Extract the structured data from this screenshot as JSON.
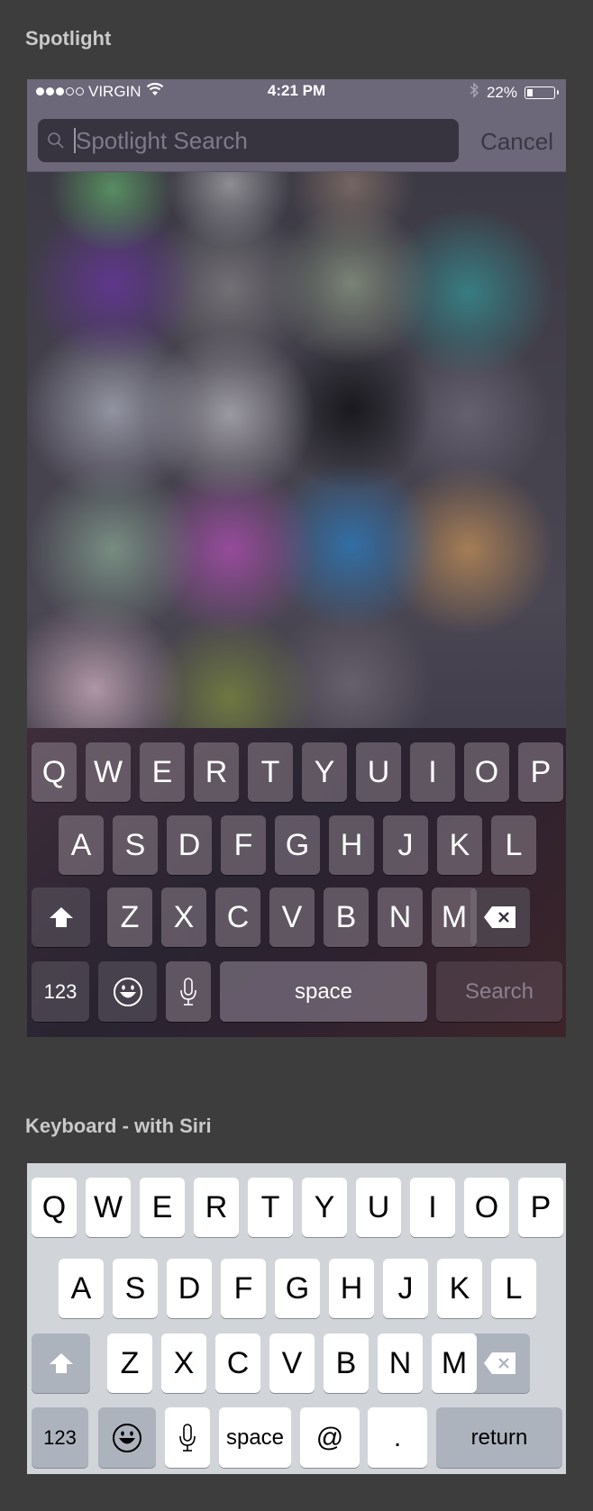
{
  "sections": {
    "spotlight_title": "Spotlight",
    "keyboard_title": "Keyboard - with Siri"
  },
  "status_bar": {
    "signal_strength_filled": 3,
    "signal_strength_total": 5,
    "carrier": "VIRGIN",
    "time": "4:21 PM",
    "battery_percent": "22%",
    "battery_level": 0.22,
    "icons": [
      "wifi-icon",
      "bluetooth-icon",
      "battery-icon"
    ]
  },
  "search": {
    "placeholder": "Spotlight Search",
    "value": "",
    "cancel_label": "Cancel"
  },
  "dark_keyboard": {
    "row1": [
      "Q",
      "W",
      "E",
      "R",
      "T",
      "Y",
      "U",
      "I",
      "O",
      "P"
    ],
    "row2": [
      "A",
      "S",
      "D",
      "F",
      "G",
      "H",
      "J",
      "K",
      "L"
    ],
    "row3": [
      "Z",
      "X",
      "C",
      "V",
      "B",
      "N",
      "M"
    ],
    "num_label": "123",
    "space_label": "space",
    "action_label": "Search"
  },
  "light_keyboard": {
    "row1": [
      "Q",
      "W",
      "E",
      "R",
      "T",
      "Y",
      "U",
      "I",
      "O",
      "P"
    ],
    "row2": [
      "A",
      "S",
      "D",
      "F",
      "G",
      "H",
      "J",
      "K",
      "L"
    ],
    "row3": [
      "Z",
      "X",
      "C",
      "V",
      "B",
      "N",
      "M"
    ],
    "num_label": "123",
    "space_label": "space",
    "at_label": "@",
    "dot_label": ".",
    "return_label": "return"
  }
}
